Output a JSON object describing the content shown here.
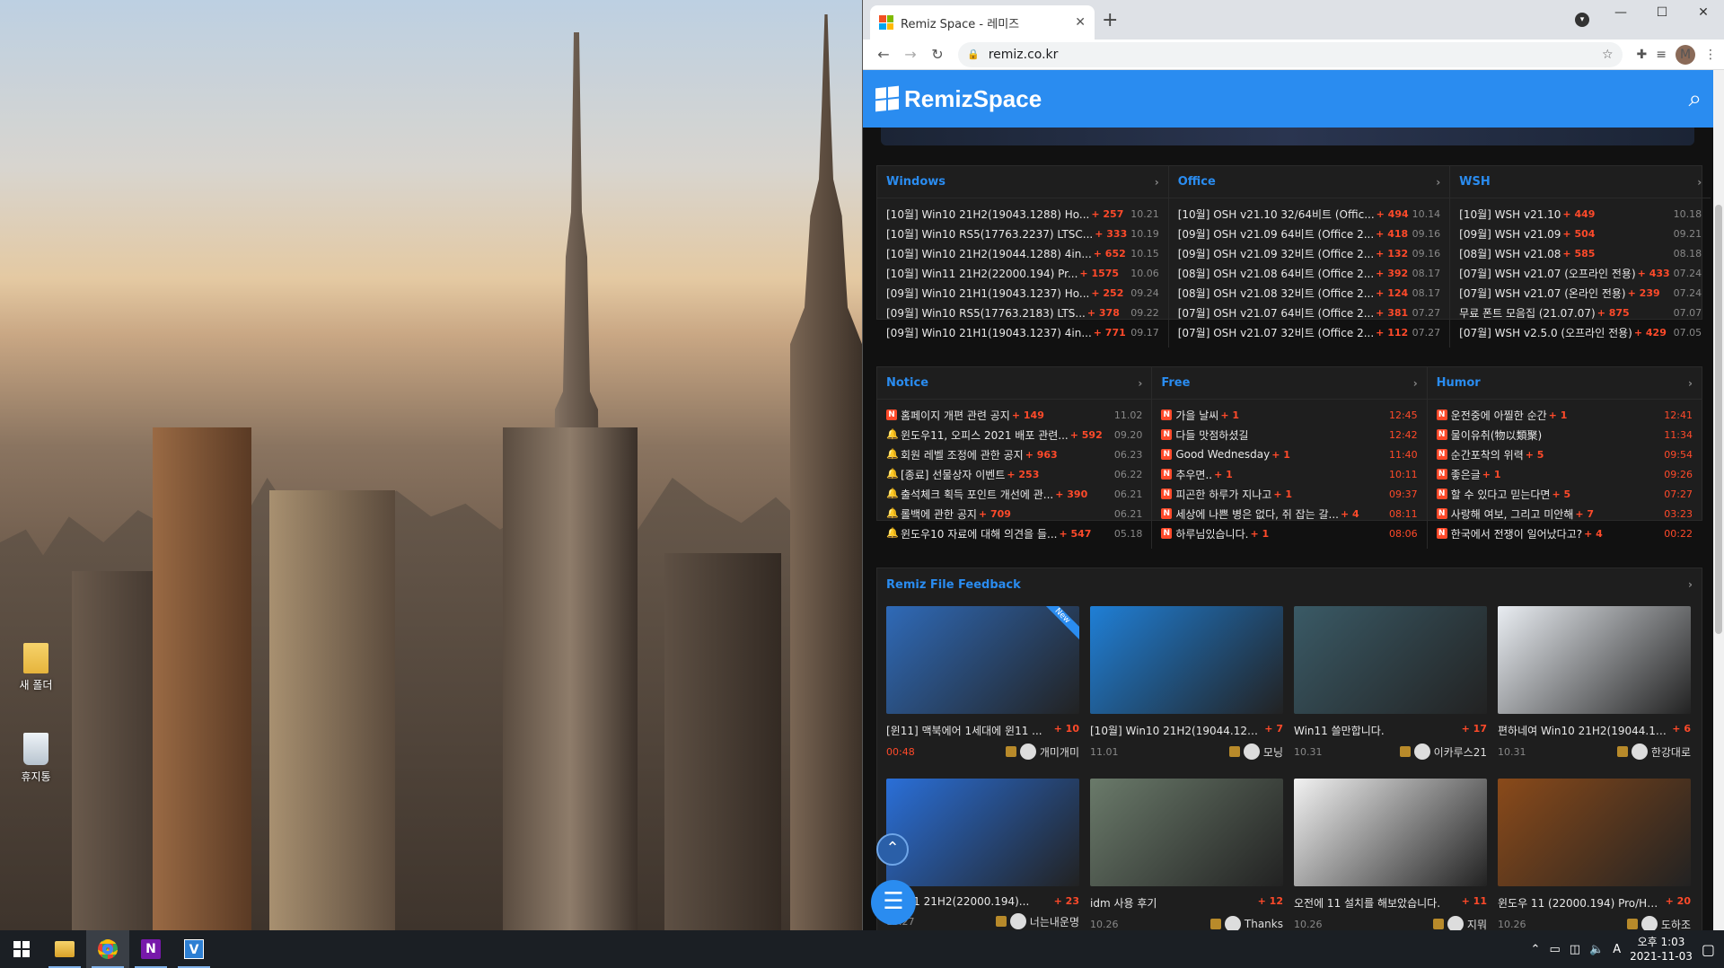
{
  "desktop": {
    "icons": [
      {
        "label": "새 폴더",
        "icon": "folder-icon"
      },
      {
        "label": "휴지통",
        "icon": "recycle-bin-icon"
      }
    ]
  },
  "browser": {
    "tab_title": "Remiz Space - 레미즈",
    "new_tab": "+",
    "close_tab": "✕",
    "url": "remiz.co.kr",
    "avatar": "M"
  },
  "site": {
    "logo": "RemizSpace",
    "boards_top": [
      {
        "name": "Windows",
        "rows": [
          {
            "t": "[10월] Win10 21H2(19043.1288) Ho...",
            "c": "+ 257",
            "d": "10.21"
          },
          {
            "t": "[10월] Win10 RS5(17763.2237) LTSC...",
            "c": "+ 333",
            "d": "10.19"
          },
          {
            "t": "[10월] Win10 21H2(19044.1288) 4in...",
            "c": "+ 652",
            "d": "10.15"
          },
          {
            "t": "[10월] Win11 21H2(22000.194) Pr...",
            "c": "+ 1575",
            "d": "10.06"
          },
          {
            "t": "[09월] Win10 21H1(19043.1237) Ho...",
            "c": "+ 252",
            "d": "09.24"
          },
          {
            "t": "[09월] Win10 RS5(17763.2183) LTS...",
            "c": "+ 378",
            "d": "09.22"
          },
          {
            "t": "[09월] Win10 21H1(19043.1237) 4in...",
            "c": "+ 771",
            "d": "09.17"
          }
        ]
      },
      {
        "name": "Office",
        "rows": [
          {
            "t": "[10월] OSH v21.10 32/64비트 (Offic...",
            "c": "+ 494",
            "d": "10.14"
          },
          {
            "t": "[09월] OSH v21.09 64비트 (Office 2...",
            "c": "+ 418",
            "d": "09.16"
          },
          {
            "t": "[09월] OSH v21.09 32비트 (Office 2...",
            "c": "+ 132",
            "d": "09.16"
          },
          {
            "t": "[08월] OSH v21.08 64비트 (Office 2...",
            "c": "+ 392",
            "d": "08.17"
          },
          {
            "t": "[08월] OSH v21.08 32비트 (Office 2...",
            "c": "+ 124",
            "d": "08.17"
          },
          {
            "t": "[07월] OSH v21.07 64비트 (Office 2...",
            "c": "+ 381",
            "d": "07.27"
          },
          {
            "t": "[07월] OSH v21.07 32비트 (Office 2...",
            "c": "+ 112",
            "d": "07.27"
          }
        ]
      },
      {
        "name": "WSH",
        "rows": [
          {
            "t": "[10월] WSH v21.10",
            "c": "+ 449",
            "d": "10.18"
          },
          {
            "t": "[09월] WSH v21.09",
            "c": "+ 504",
            "d": "09.21"
          },
          {
            "t": "[08월] WSH v21.08",
            "c": "+ 585",
            "d": "08.18"
          },
          {
            "t": "[07월] WSH v21.07 (오프라인 전용)",
            "c": "+ 433",
            "d": "07.24"
          },
          {
            "t": "[07월] WSH v21.07 (온라인 전용)",
            "c": "+ 239",
            "d": "07.24"
          },
          {
            "t": "무료 폰트 모음집 (21.07.07)",
            "c": "+ 875",
            "d": "07.07"
          },
          {
            "t": "[07월] WSH v2.5.0 (오프라인 전용)",
            "c": "+ 429",
            "d": "07.05"
          }
        ]
      }
    ],
    "boards_mid": [
      {
        "name": "Notice",
        "rows": [
          {
            "ic": "N",
            "t": "홈페이지 개편 관련 공지",
            "c": "+ 149",
            "d": "11.02"
          },
          {
            "ic": "bell",
            "t": "윈도우11, 오피스 2021 배포 관련...",
            "c": "+ 592",
            "d": "09.20"
          },
          {
            "ic": "bell",
            "t": "회원 레벨 조정에 관한 공지",
            "c": "+ 963",
            "d": "06.23"
          },
          {
            "ic": "bell",
            "t": "[종료] 선물상자 이벤트",
            "c": "+ 253",
            "d": "06.22"
          },
          {
            "ic": "bell",
            "t": "출석체크 획득 포인트 개선에 관...",
            "c": "+ 390",
            "d": "06.21"
          },
          {
            "ic": "bell",
            "t": "롤백에 관한 공지",
            "c": "+ 709",
            "d": "06.21"
          },
          {
            "ic": "bell",
            "t": "윈도우10 자료에 대해 의견을 들...",
            "c": "+ 547",
            "d": "05.18"
          }
        ]
      },
      {
        "name": "Free",
        "rows": [
          {
            "ic": "N",
            "t": "가을 날씨",
            "c": "+ 1",
            "d": "12:45"
          },
          {
            "ic": "N",
            "t": "다들 맛점하셨길",
            "c": "",
            "d": "12:42"
          },
          {
            "ic": "N",
            "t": "Good Wednesday",
            "c": "+ 1",
            "d": "11:40"
          },
          {
            "ic": "N",
            "t": "추우면..",
            "c": "+ 1",
            "d": "10:11"
          },
          {
            "ic": "N",
            "t": "피곤한 하루가 지나고",
            "c": "+ 1",
            "d": "09:37"
          },
          {
            "ic": "N",
            "t": "세상에 나쁜 병은 없다, 쥐 잡는 갈...",
            "c": "+ 4",
            "d": "08:11"
          },
          {
            "ic": "N",
            "t": "하루님있습니다.",
            "c": "+ 1",
            "d": "08:06"
          }
        ]
      },
      {
        "name": "Humor",
        "rows": [
          {
            "ic": "N",
            "t": "운전중에 아찔한 순간",
            "c": "+ 1",
            "d": "12:41"
          },
          {
            "ic": "N",
            "t": "물이유취(物以類聚)",
            "c": "",
            "d": "11:34"
          },
          {
            "ic": "N",
            "t": "순간포착의 위력",
            "c": "+ 5",
            "d": "09:54"
          },
          {
            "ic": "N",
            "t": "좋은글",
            "c": "+ 1",
            "d": "09:26"
          },
          {
            "ic": "N",
            "t": "할 수 있다고 믿는다면",
            "c": "+ 5",
            "d": "07:27"
          },
          {
            "ic": "N",
            "t": "사랑해 여보, 그리고 미안해",
            "c": "+ 7",
            "d": "03:23"
          },
          {
            "ic": "N",
            "t": "한국에서 전쟁이 일어났다고?",
            "c": "+ 4",
            "d": "00:22"
          }
        ]
      }
    ],
    "feedback_title": "Remiz File Feedback",
    "new_badge": "New",
    "cards": [
      {
        "t": "[윈11] 맥북에어 1세대에 윈11 ...",
        "c": "+ 10",
        "date": "00:48",
        "user": "개미개미",
        "thumb": "#2f6ab8"
      },
      {
        "t": "[10월] Win10 21H2(19044.1288...",
        "c": "+ 7",
        "date": "11.01",
        "user": "모닝",
        "thumb": "#1f7fd6"
      },
      {
        "t": "Win11 쓸만합니다.",
        "c": "+ 17",
        "date": "10.31",
        "user": "이카루스21",
        "thumb": "#3a5a66"
      },
      {
        "t": "편하네여 Win10 21H2(19044.12...",
        "c": "+ 6",
        "date": "10.31",
        "user": "한강대로",
        "thumb": "#e9edf2"
      },
      {
        "t": "Win11 21H2(22000.194)...",
        "c": "+ 23",
        "date": "10.27",
        "user": "너는내운명",
        "thumb": "#2a6fd8"
      },
      {
        "t": "idm 사용 후기",
        "c": "+ 12",
        "date": "10.26",
        "user": "Thanks",
        "thumb": "#6a7a6a"
      },
      {
        "t": "오전에 11 설치를 해보았습니다.",
        "c": "+ 11",
        "date": "10.26",
        "user": "지뭐",
        "thumb": "#f2f2f2"
      },
      {
        "t": "윈도우 11 (22000.194) Pro/Ho...",
        "c": "+ 20",
        "date": "10.26",
        "user": "도하조",
        "thumb": "#8a4a1a"
      }
    ]
  },
  "taskbar": {
    "apps": [
      "windows-start-icon",
      "file-explorer-icon",
      "chrome-icon",
      "onenote-icon",
      "v-app-icon"
    ],
    "ime": "A",
    "time": "오후 1:03",
    "date": "2021-11-03"
  }
}
